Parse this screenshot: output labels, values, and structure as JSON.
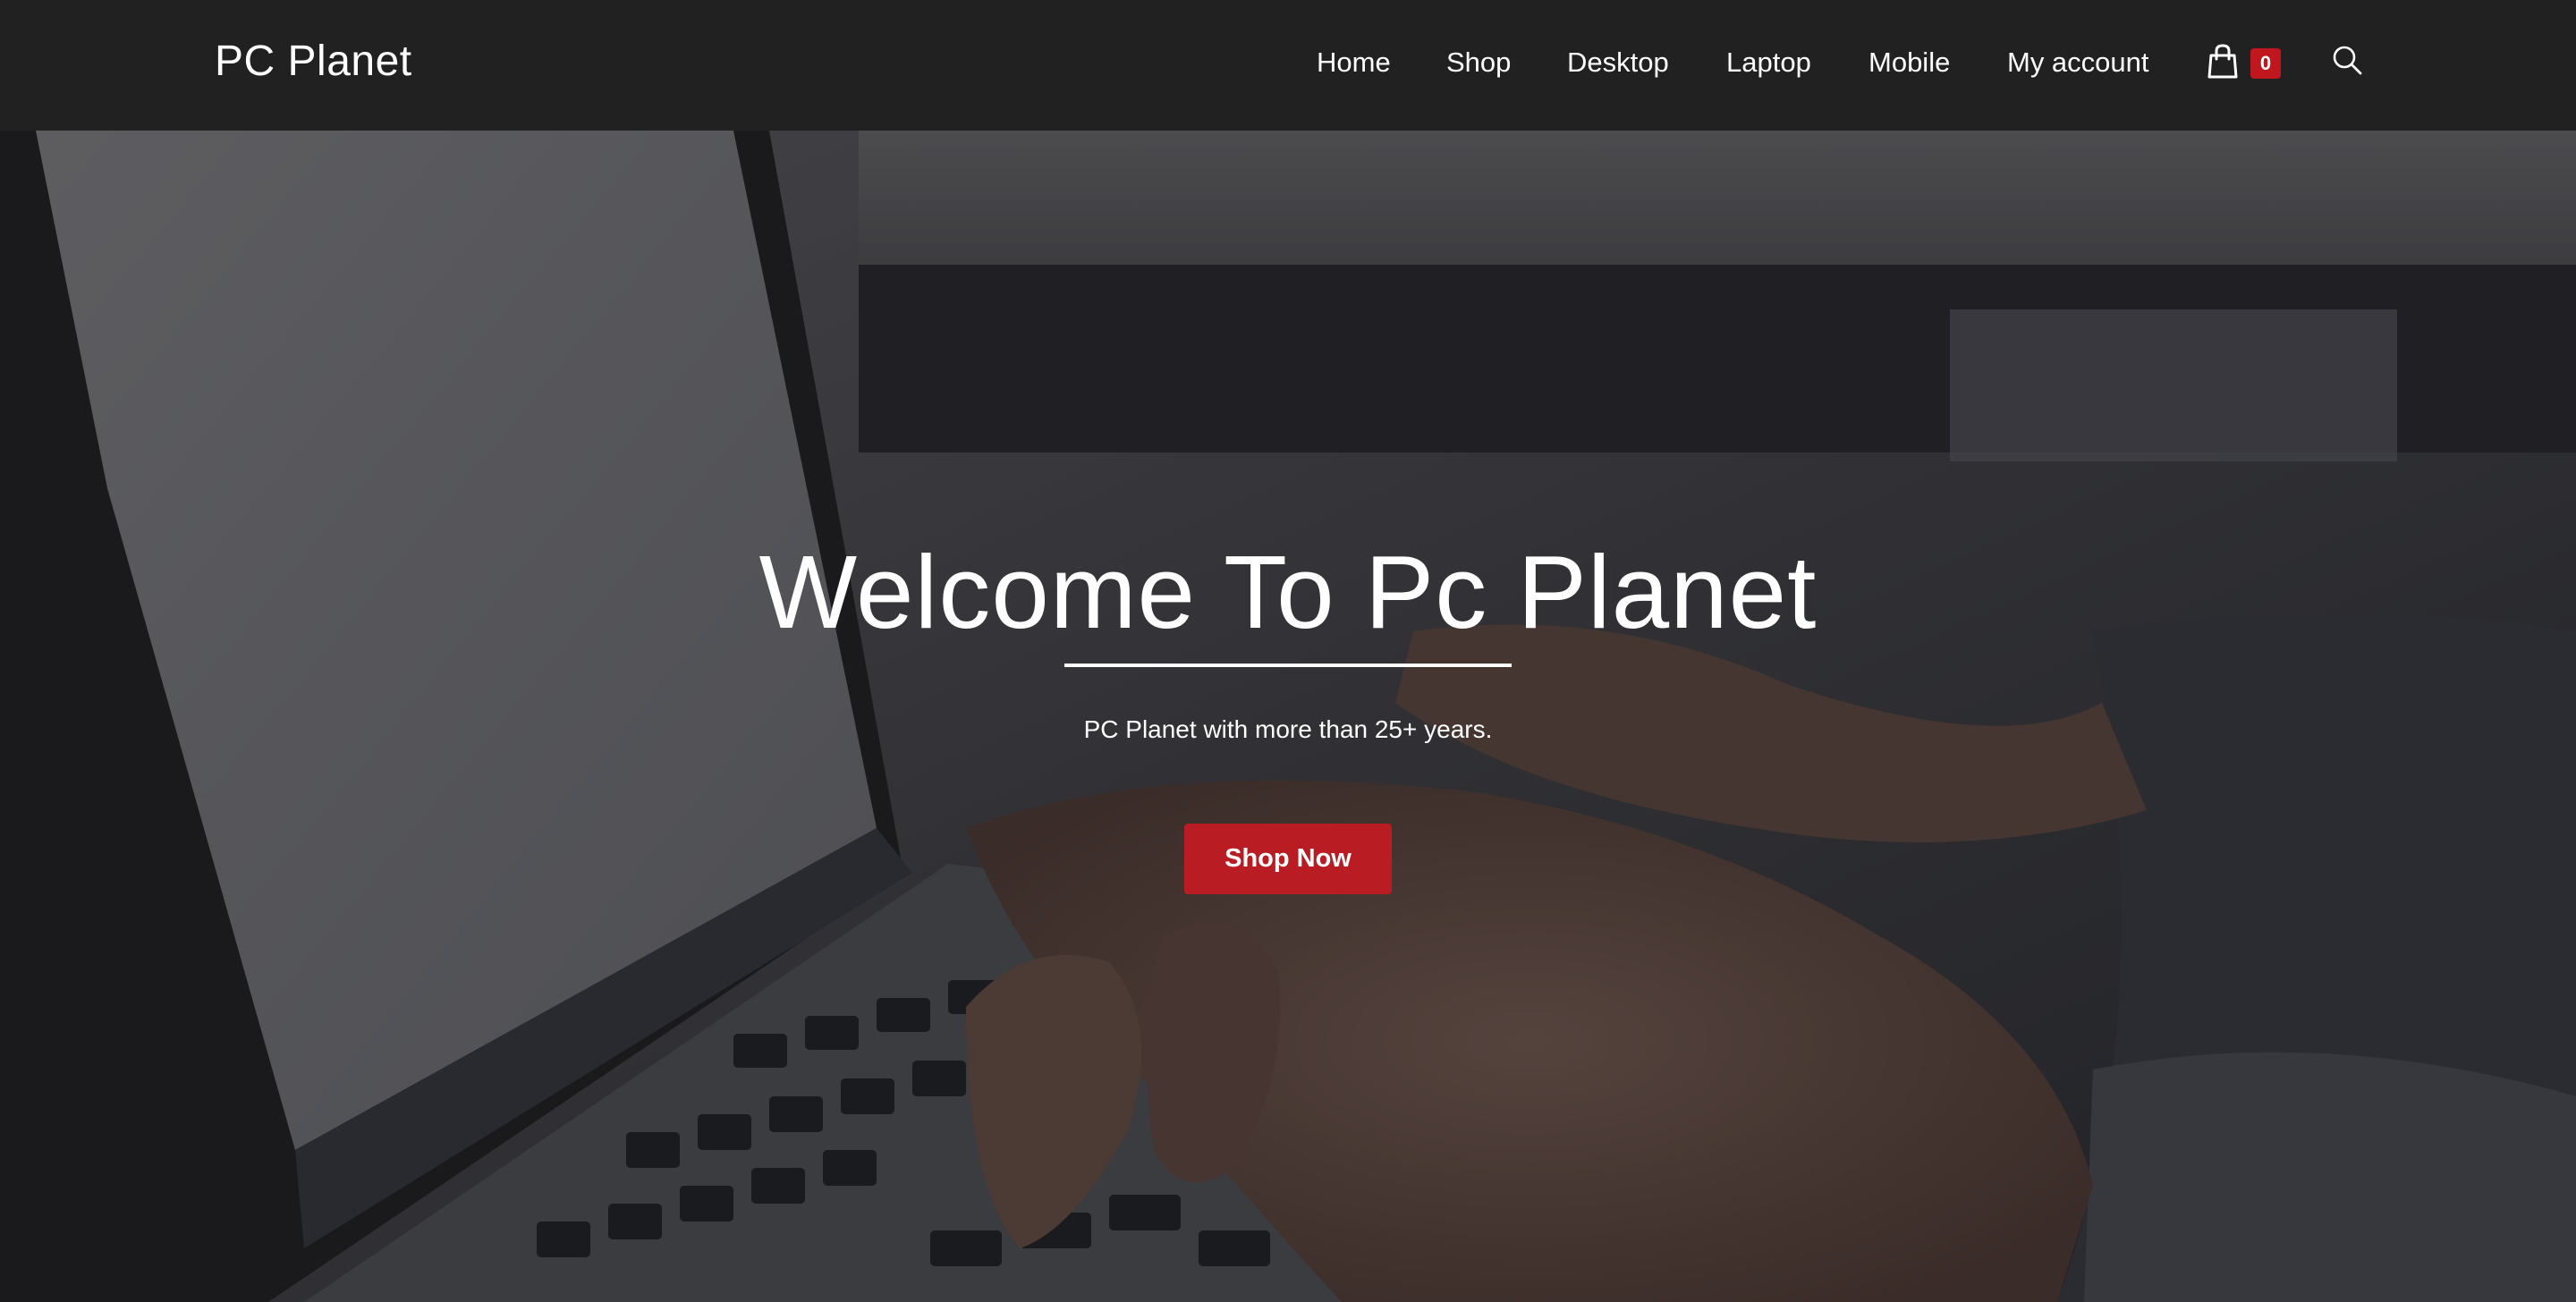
{
  "brand": {
    "name": "PC Planet"
  },
  "nav": {
    "items": [
      {
        "label": "Home"
      },
      {
        "label": "Shop"
      },
      {
        "label": "Desktop"
      },
      {
        "label": "Laptop"
      },
      {
        "label": "Mobile"
      },
      {
        "label": "My account"
      }
    ],
    "cart_count": "0",
    "cart_icon": "shopping-bag-icon",
    "search_icon": "search-icon"
  },
  "hero": {
    "title": "Welcome To Pc Planet",
    "subtitle": "PC Planet with more than 25+ years.",
    "cta_label": "Shop Now",
    "background_image": "laptop-typing-photo"
  },
  "colors": {
    "header_bg": "#212121",
    "accent": "#b91c22",
    "text": "#ffffff"
  }
}
